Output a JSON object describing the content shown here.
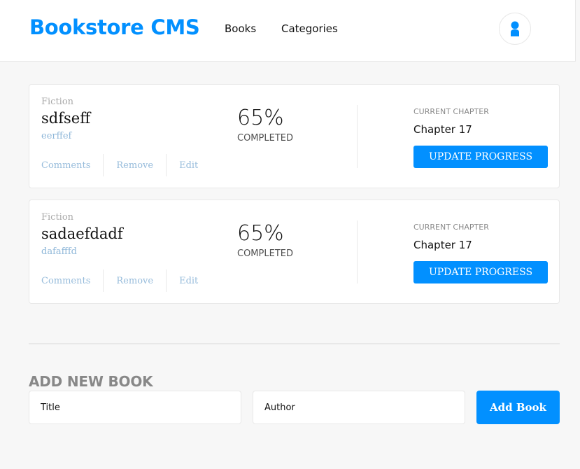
{
  "header": {
    "logo": "Bookstore CMS",
    "nav": [
      "Books",
      "Categories"
    ],
    "avatar_icon": "user-icon"
  },
  "books": [
    {
      "genre": "Fiction",
      "title": "sdfseff",
      "author": "eerffef",
      "actions": [
        "Comments",
        "Remove",
        "Edit"
      ],
      "percent": "65%",
      "progress": 65,
      "completed_label": "COMPLETED",
      "chapter_label": "CURRENT CHAPTER",
      "chapter": "Chapter 17",
      "update_label": "UPDATE PROGRESS"
    },
    {
      "genre": "Fiction",
      "title": "sadaefdadf",
      "author": "dafafffd",
      "actions": [
        "Comments",
        "Remove",
        "Edit"
      ],
      "percent": "65%",
      "progress": 65,
      "completed_label": "COMPLETED",
      "chapter_label": "CURRENT CHAPTER",
      "chapter": "Chapter 17",
      "update_label": "UPDATE PROGRESS"
    }
  ],
  "add_form": {
    "heading": "ADD NEW BOOK",
    "title_placeholder": "Title",
    "author_placeholder": "Author",
    "submit_label": "Add Book"
  },
  "colors": {
    "accent": "#0290ff",
    "background": "#f7f7f7"
  }
}
